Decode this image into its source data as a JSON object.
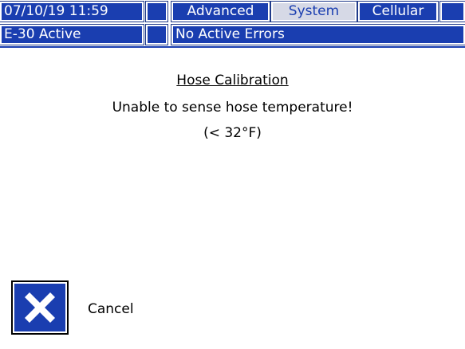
{
  "status_bar": {
    "datetime": "07/10/19 11:59",
    "tabs": [
      {
        "label": "Advanced",
        "selected": false
      },
      {
        "label": "System",
        "selected": true
      },
      {
        "label": "Cellular",
        "selected": false
      }
    ]
  },
  "info_bar": {
    "mode": "E-30 Active",
    "errors": "No Active Errors"
  },
  "dialog": {
    "title": "Hose Calibration",
    "message_line1": "Unable to sense hose temperature!",
    "message_line2": "(< 32°F)"
  },
  "actions": {
    "cancel_label": "Cancel",
    "cancel_icon": "x-icon"
  },
  "colors": {
    "accent": "#1a3eb0",
    "selected_tab_bg": "#d6d9e6"
  }
}
